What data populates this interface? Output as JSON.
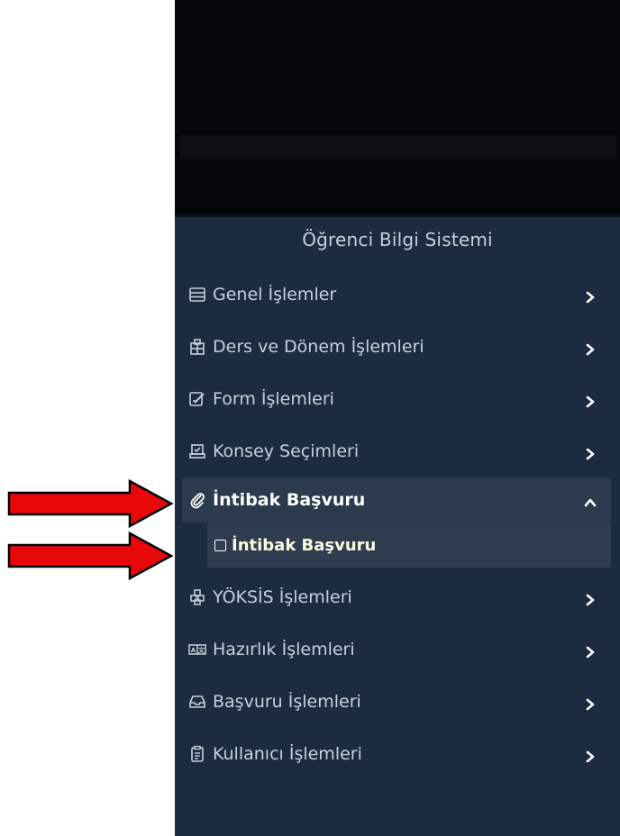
{
  "sidebar": {
    "system_title": "Öğrenci Bilgi Sistemi",
    "items": [
      {
        "label": "Genel İşlemler",
        "icon": "table-icon",
        "state": "collapsed"
      },
      {
        "label": "Ders ve Dönem İşlemleri",
        "icon": "building-icon",
        "state": "collapsed"
      },
      {
        "label": "Form İşlemleri",
        "icon": "form-edit-icon",
        "state": "collapsed"
      },
      {
        "label": "Konsey Seçimleri",
        "icon": "ballot-icon",
        "state": "collapsed"
      },
      {
        "label": "İntibak Başvuru",
        "icon": "paperclip-icon",
        "state": "expanded",
        "children": [
          {
            "label": "İntibak Başvuru",
            "icon": "square-icon"
          }
        ]
      },
      {
        "label": "YÖKSİS İşlemleri",
        "icon": "boxes-icon",
        "state": "collapsed"
      },
      {
        "label": "Hazırlık İşlemleri",
        "icon": "translate-icon",
        "state": "collapsed"
      },
      {
        "label": "Başvuru İşlemleri",
        "icon": "inbox-icon",
        "state": "collapsed"
      },
      {
        "label": "Kullanıcı İşlemleri",
        "icon": "clipboard-icon",
        "state": "collapsed"
      }
    ]
  },
  "colors": {
    "sidebar_bg": "#1c2c40",
    "menu_text": "#c6d0db",
    "active_bg": "#2b3a4c",
    "arrow_fill": "#e8080a"
  }
}
